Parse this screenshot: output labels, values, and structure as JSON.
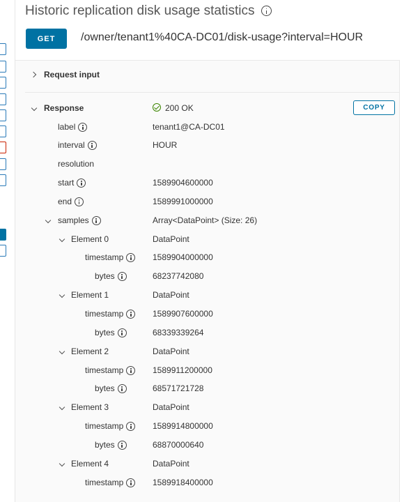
{
  "header": {
    "title": "Historic replication disk usage statistics",
    "method_label": "GET",
    "endpoint": "/owner/tenant1%40CA-DC01/disk-usage?interval=HOUR"
  },
  "request": {
    "label": "Request input"
  },
  "response": {
    "label": "Response",
    "status": "200 OK",
    "copy_label": "COPY",
    "fields": {
      "label": {
        "key": "label",
        "value": "tenant1@CA-DC01"
      },
      "interval": {
        "key": "interval",
        "value": "HOUR"
      },
      "resolution": {
        "key": "resolution",
        "value": ""
      },
      "start": {
        "key": "start",
        "value": "1589904600000"
      },
      "end": {
        "key": "end",
        "value": "1589991000000"
      },
      "samples": {
        "key": "samples",
        "value": "Array<DataPoint> (Size: 26)"
      }
    },
    "elements": [
      {
        "label": "Element 0",
        "type": "DataPoint",
        "timestamp_key": "timestamp",
        "timestamp": "1589904000000",
        "bytes_key": "bytes",
        "bytes": "68237742080"
      },
      {
        "label": "Element 1",
        "type": "DataPoint",
        "timestamp_key": "timestamp",
        "timestamp": "1589907600000",
        "bytes_key": "bytes",
        "bytes": "68339339264"
      },
      {
        "label": "Element 2",
        "type": "DataPoint",
        "timestamp_key": "timestamp",
        "timestamp": "1589911200000",
        "bytes_key": "bytes",
        "bytes": "68571721728"
      },
      {
        "label": "Element 3",
        "type": "DataPoint",
        "timestamp_key": "timestamp",
        "timestamp": "1589914800000",
        "bytes_key": "bytes",
        "bytes": "68870000640"
      },
      {
        "label": "Element 4",
        "type": "DataPoint",
        "timestamp_key": "timestamp",
        "timestamp": "1589918400000"
      }
    ]
  },
  "colors": {
    "primary": "#0072a3",
    "success": "#3c8500",
    "error": "#c92100"
  },
  "icons": [
    "info-icon",
    "success-check-icon",
    "chevron-down-icon",
    "chevron-right-icon"
  ]
}
